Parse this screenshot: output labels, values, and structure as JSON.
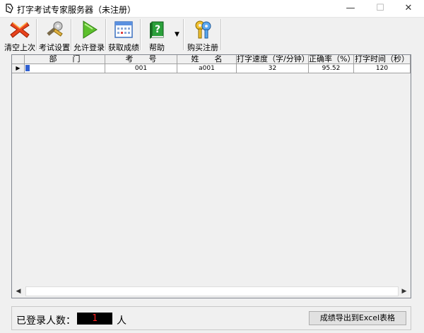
{
  "window": {
    "title": "打字考试专家服务器（未注册）",
    "minimize": "—",
    "maximize": "☐",
    "close": "✕"
  },
  "toolbar": {
    "clear_label": "清空上次",
    "settings_label": "考试设置",
    "allow_login_label": "允许登录",
    "get_scores_label": "获取成绩",
    "help_label": "帮助",
    "dropdown_glyph": "▼",
    "register_label": "购买注册"
  },
  "table": {
    "headers": [
      "部　　门",
      "考　　号",
      "姓　　名",
      "打字速度（字/分钟）",
      "正确率（%）",
      "打字时间（秒）"
    ],
    "rows": [
      [
        "▶",
        "",
        "001",
        "a001",
        "32",
        "95.52",
        "120"
      ]
    ]
  },
  "scroll": {
    "left": "◀",
    "right": "▶"
  },
  "footer": {
    "count_label": "已登录人数：",
    "count_value": "1",
    "count_unit": "人",
    "export_label": "成绩导出到Excel表格"
  }
}
